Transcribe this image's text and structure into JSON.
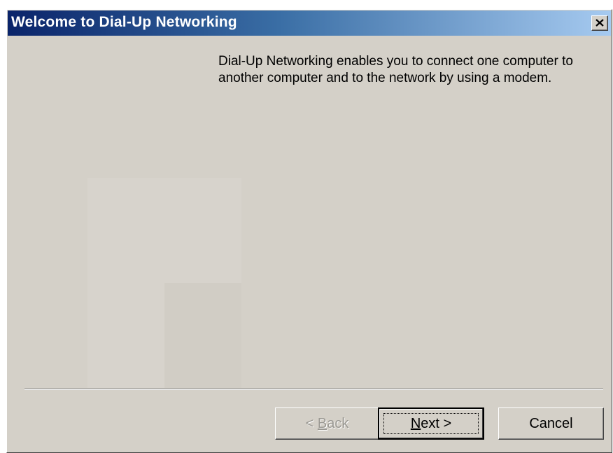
{
  "window": {
    "title": "Welcome to Dial-Up Networking"
  },
  "content": {
    "intro_text": "Dial-Up Networking enables you to connect one computer to another computer and to the network by using a modem."
  },
  "buttons": {
    "back": {
      "prefix": "< ",
      "mnemonic": "B",
      "rest": "ack",
      "enabled": false
    },
    "next": {
      "mnemonic": "N",
      "rest": "ext >",
      "default": true
    },
    "cancel": {
      "label": "Cancel"
    }
  },
  "icons": {
    "close": "close-icon",
    "watermark": "wizard-watermark-icon"
  },
  "colors": {
    "titlebar_start": "#0a246a",
    "titlebar_end": "#a6caf0",
    "dialog_face": "#d4d0c8"
  }
}
